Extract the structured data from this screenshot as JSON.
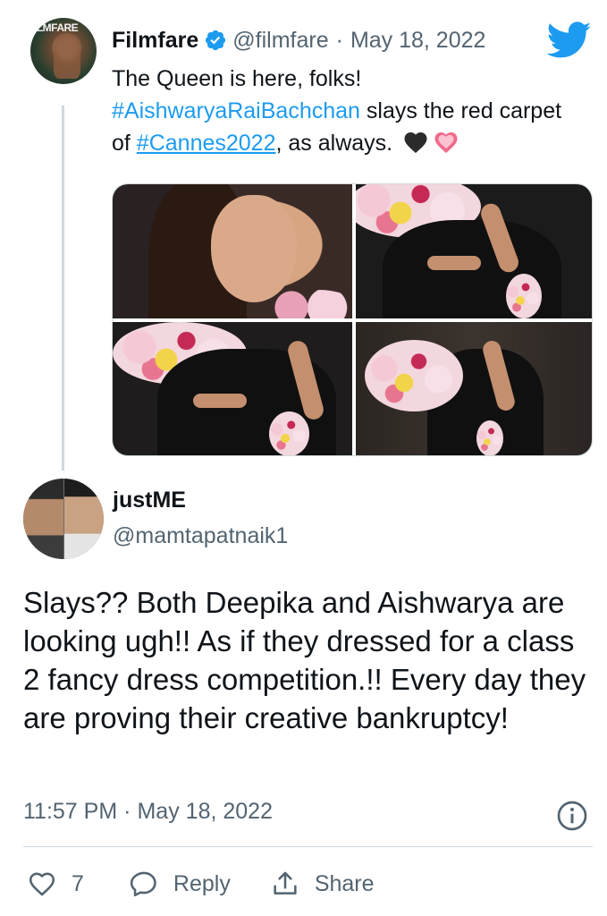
{
  "parent_tweet": {
    "author_name": "Filmfare",
    "handle": "@filmfare",
    "separator": "·",
    "date": "May 18, 2022",
    "avatar_text": "ILMFARE",
    "text_line1": "The Queen is here, folks!",
    "hashtag1": "#AishwaryaRaiBachchan",
    "text_after_hashtag1": " slays the red carpet of ",
    "hashtag2": "#Cannes2022",
    "text_after_hashtag2": ", as always.",
    "media_count": 4
  },
  "reply_tweet": {
    "author_name": "justME",
    "handle": "@mamtapatnaik1",
    "text": "Slays?? Both Deepika and Aishwarya are looking ugh!! As if they dressed for a class 2 fancy dress competition.!! Every day they are proving their creative bankruptcy!",
    "time": "11:57 PM",
    "separator": "·",
    "date": "May 18, 2022"
  },
  "actions": {
    "like_count": "7",
    "reply_label": "Reply",
    "share_label": "Share"
  },
  "colors": {
    "accent": "#1d9bf0",
    "secondary_text": "#536471",
    "border": "#cfd9de"
  },
  "icons": [
    "verified-badge-icon",
    "twitter-bird-icon",
    "black-heart-icon",
    "sparkling-heart-icon",
    "info-icon",
    "like-icon",
    "reply-icon",
    "share-icon"
  ]
}
